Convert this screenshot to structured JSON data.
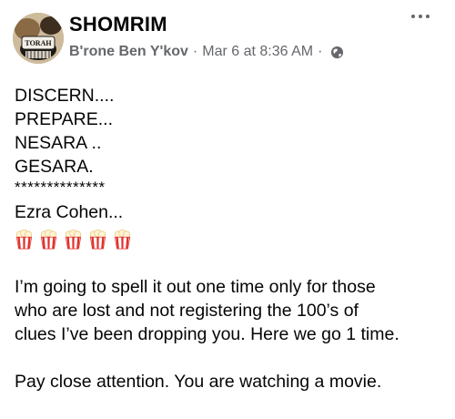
{
  "post": {
    "group_name": "SHOMRIM",
    "author": "B'rone Ben Y'kov",
    "separator": "·",
    "timestamp": "Mar 6 at 8:36 AM",
    "privacy_icon": "globe-icon",
    "avatar_label": "TORAH",
    "more_icon": "more-horizontal-icon"
  },
  "content": {
    "lines": [
      "DISCERN....",
      "PREPARE...",
      "NESARA ..",
      "GESARA."
    ],
    "stars": "**************",
    "ezra_line": "Ezra Cohen...",
    "emoji": [
      "popcorn",
      "popcorn",
      "popcorn",
      "popcorn",
      "popcorn"
    ],
    "paragraph1": [
      "I’m going to spell it out one time only for those",
      "who are lost and not registering the 100’s of",
      "clues I’ve been dropping you. Here we go 1 time."
    ],
    "paragraph2": "Pay close attention. You are watching a movie."
  },
  "colors": {
    "text": "#050505",
    "secondary": "#65676b",
    "popcorn_red": "#e0312c"
  }
}
